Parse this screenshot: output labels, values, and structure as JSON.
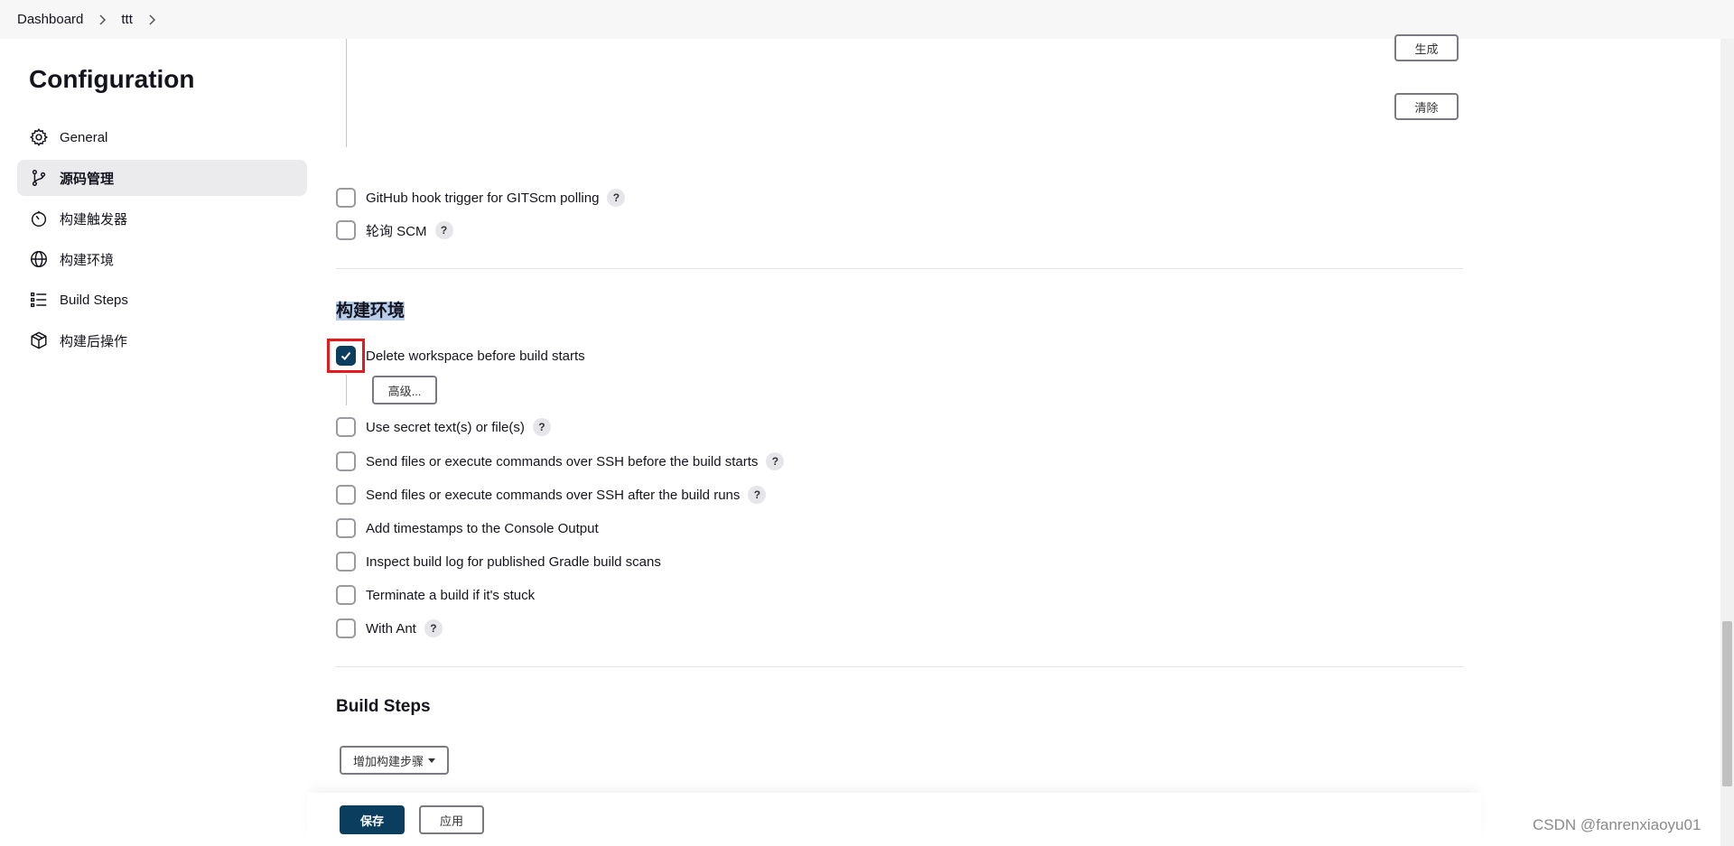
{
  "breadcrumb": {
    "items": [
      "Dashboard",
      "ttt"
    ]
  },
  "sidebar": {
    "title": "Configuration",
    "items": [
      {
        "label": "General",
        "icon": "gear-icon"
      },
      {
        "label": "源码管理",
        "icon": "branch-icon",
        "active": true
      },
      {
        "label": "构建触发器",
        "icon": "timer-icon"
      },
      {
        "label": "构建环境",
        "icon": "globe-icon"
      },
      {
        "label": "Build Steps",
        "icon": "list-icon"
      },
      {
        "label": "构建后操作",
        "icon": "package-icon"
      }
    ]
  },
  "top_buttons": {
    "generate": "生成",
    "clear": "清除"
  },
  "triggers": [
    {
      "label": "GitHub hook trigger for GITScm polling",
      "checked": false,
      "help": true
    },
    {
      "label": "轮询 SCM",
      "checked": false,
      "help": true
    }
  ],
  "build_env": {
    "title": "构建环境",
    "options": [
      {
        "label": "Delete workspace before build starts",
        "checked": true,
        "help": false
      },
      {
        "label": "Use secret text(s) or file(s)",
        "checked": false,
        "help": true
      },
      {
        "label": "Send files or execute commands over SSH before the build starts",
        "checked": false,
        "help": true
      },
      {
        "label": "Send files or execute commands over SSH after the build runs",
        "checked": false,
        "help": true
      },
      {
        "label": "Add timestamps to the Console Output",
        "checked": false,
        "help": false
      },
      {
        "label": "Inspect build log for published Gradle build scans",
        "checked": false,
        "help": false
      },
      {
        "label": "Terminate a build if it's stuck",
        "checked": false,
        "help": false
      },
      {
        "label": "With Ant",
        "checked": false,
        "help": true
      }
    ],
    "advanced_label": "高级..."
  },
  "build_steps": {
    "title": "Build Steps",
    "add_label": "增加构建步骤"
  },
  "footer": {
    "save_label": "保存",
    "apply_label": "应用"
  },
  "help_glyph": "?",
  "watermark": "CSDN @fanrenxiaoyu01",
  "colors": {
    "primary": "#0b3d5e",
    "highlight_box": "#e8191c",
    "active_bg": "#ebebee"
  }
}
